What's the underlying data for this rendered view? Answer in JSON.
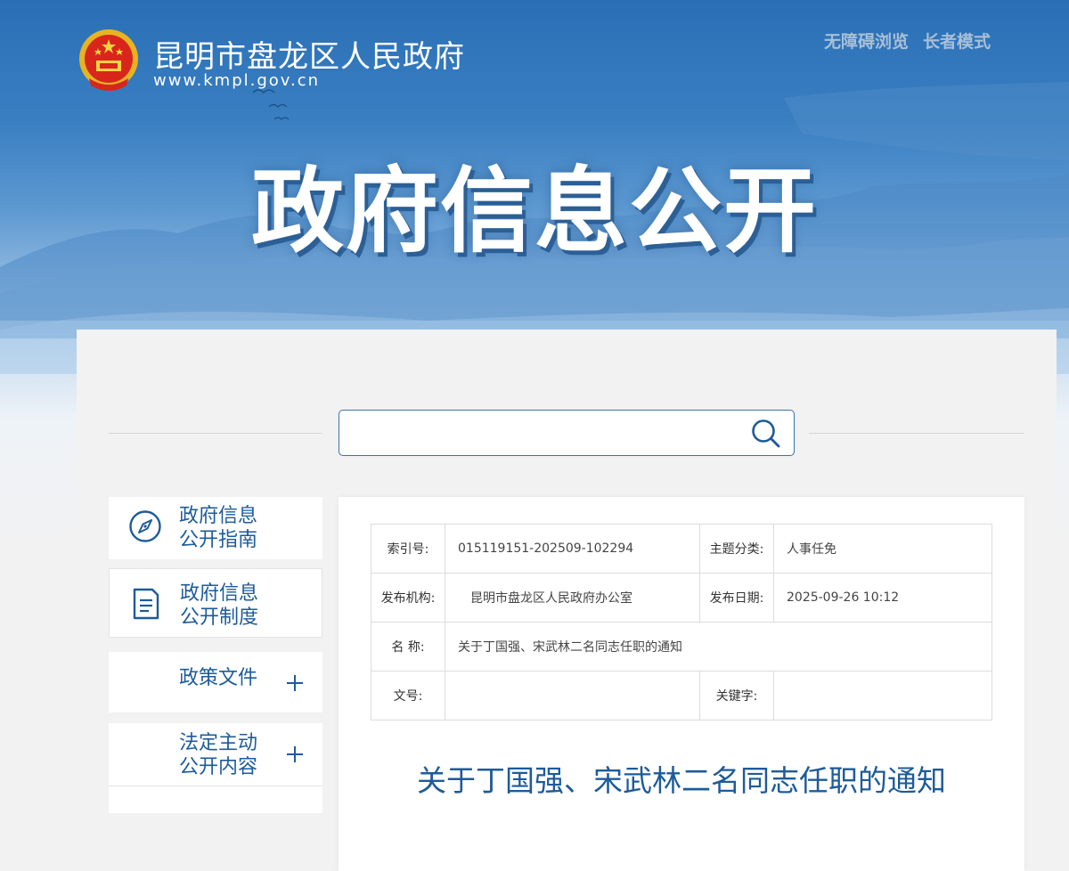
{
  "header": {
    "site_name": "昆明市盘龙区人民政府",
    "site_url": "www.kmpl.gov.cn",
    "accessibility_label": "无障碍浏览",
    "elder_mode_label": "长者模式",
    "hero_title": "政府信息公开"
  },
  "search": {
    "value": "",
    "placeholder": ""
  },
  "sidebar": {
    "items": [
      {
        "label_line1": "政府信息",
        "label_line2": "公开指南",
        "icon": "compass-icon"
      },
      {
        "label_line1": "政府信息",
        "label_line2": "公开制度",
        "icon": "document-icon"
      },
      {
        "label_line1": "政策文件",
        "label_line2": "",
        "icon": "plus-icon"
      },
      {
        "label_line1": "法定主动",
        "label_line2": "公开内容",
        "icon": "plus-icon"
      }
    ]
  },
  "meta_table": {
    "index_key": "索引号:",
    "index_value": "015119151-202509-102294",
    "topic_key": "主题分类:",
    "topic_value": "人事任免",
    "publisher_key": "发布机构:",
    "publisher_value": "昆明市盘龙区人民政府办公室",
    "date_key": "发布日期:",
    "date_value": "2025-09-26 10:12",
    "name_key": "名 称:",
    "name_value": "关于丁国强、宋武林二名同志任职的通知",
    "docno_key": "文号:",
    "docno_value": "",
    "keyword_key": "关键字:",
    "keyword_value": ""
  },
  "document": {
    "title": "关于丁国强、宋武林二名同志任职的通知"
  },
  "colors": {
    "brand_blue": "#1d5b9a",
    "banner_top": "#2a6fb5",
    "page_bg": "#f2f2f2"
  }
}
